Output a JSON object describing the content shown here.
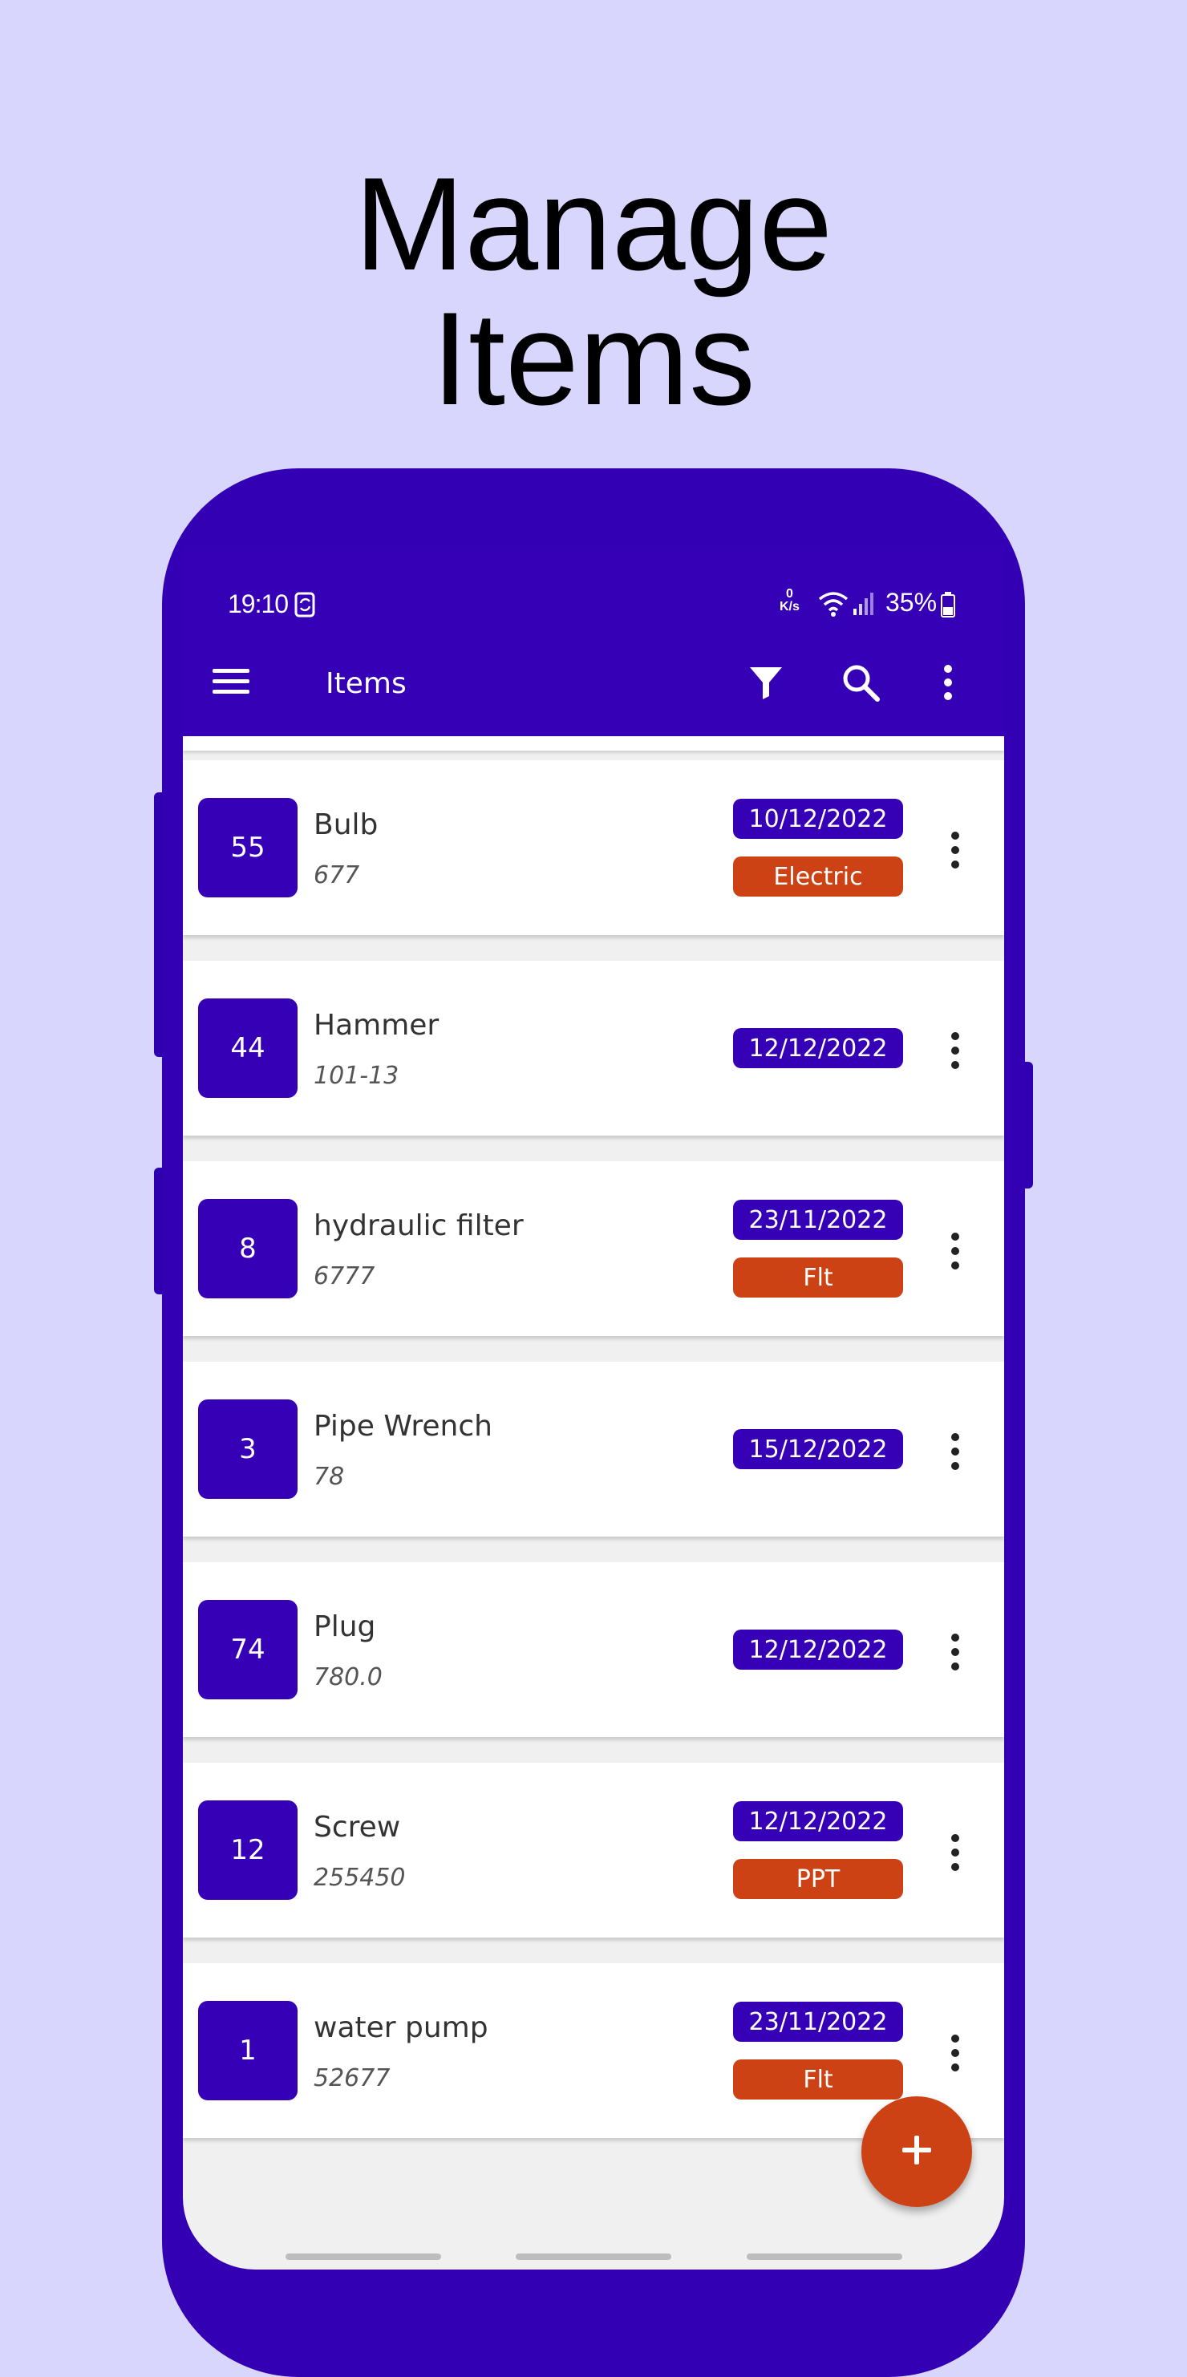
{
  "headline": {
    "line1": "Manage",
    "line2": "Items"
  },
  "status_bar": {
    "time": "19:10",
    "net_speed_value": "0",
    "net_speed_unit": "K/s",
    "battery": "35%"
  },
  "app_bar": {
    "title": "Items"
  },
  "items": [
    {
      "qty": "55",
      "name": "Bulb",
      "code": "677",
      "date": "10/12/2022",
      "category": "Electric"
    },
    {
      "qty": "44",
      "name": "Hammer",
      "code": "101-13",
      "date": "12/12/2022",
      "category": ""
    },
    {
      "qty": "8",
      "name": "hydraulic filter",
      "code": "6777",
      "date": "23/11/2022",
      "category": "Flt"
    },
    {
      "qty": "3",
      "name": "Pipe Wrench",
      "code": "78",
      "date": "15/12/2022",
      "category": ""
    },
    {
      "qty": "74",
      "name": "Plug",
      "code": "780.0",
      "date": "12/12/2022",
      "category": ""
    },
    {
      "qty": "12",
      "name": "Screw",
      "code": "255450",
      "date": "12/12/2022",
      "category": "PPT"
    },
    {
      "qty": "1",
      "name": "water pump",
      "code": "52677",
      "date": "23/11/2022",
      "category": "Flt"
    }
  ],
  "colors": {
    "primary": "#3600b6",
    "accent": "#cc4214",
    "background": "#d9d6fd"
  }
}
